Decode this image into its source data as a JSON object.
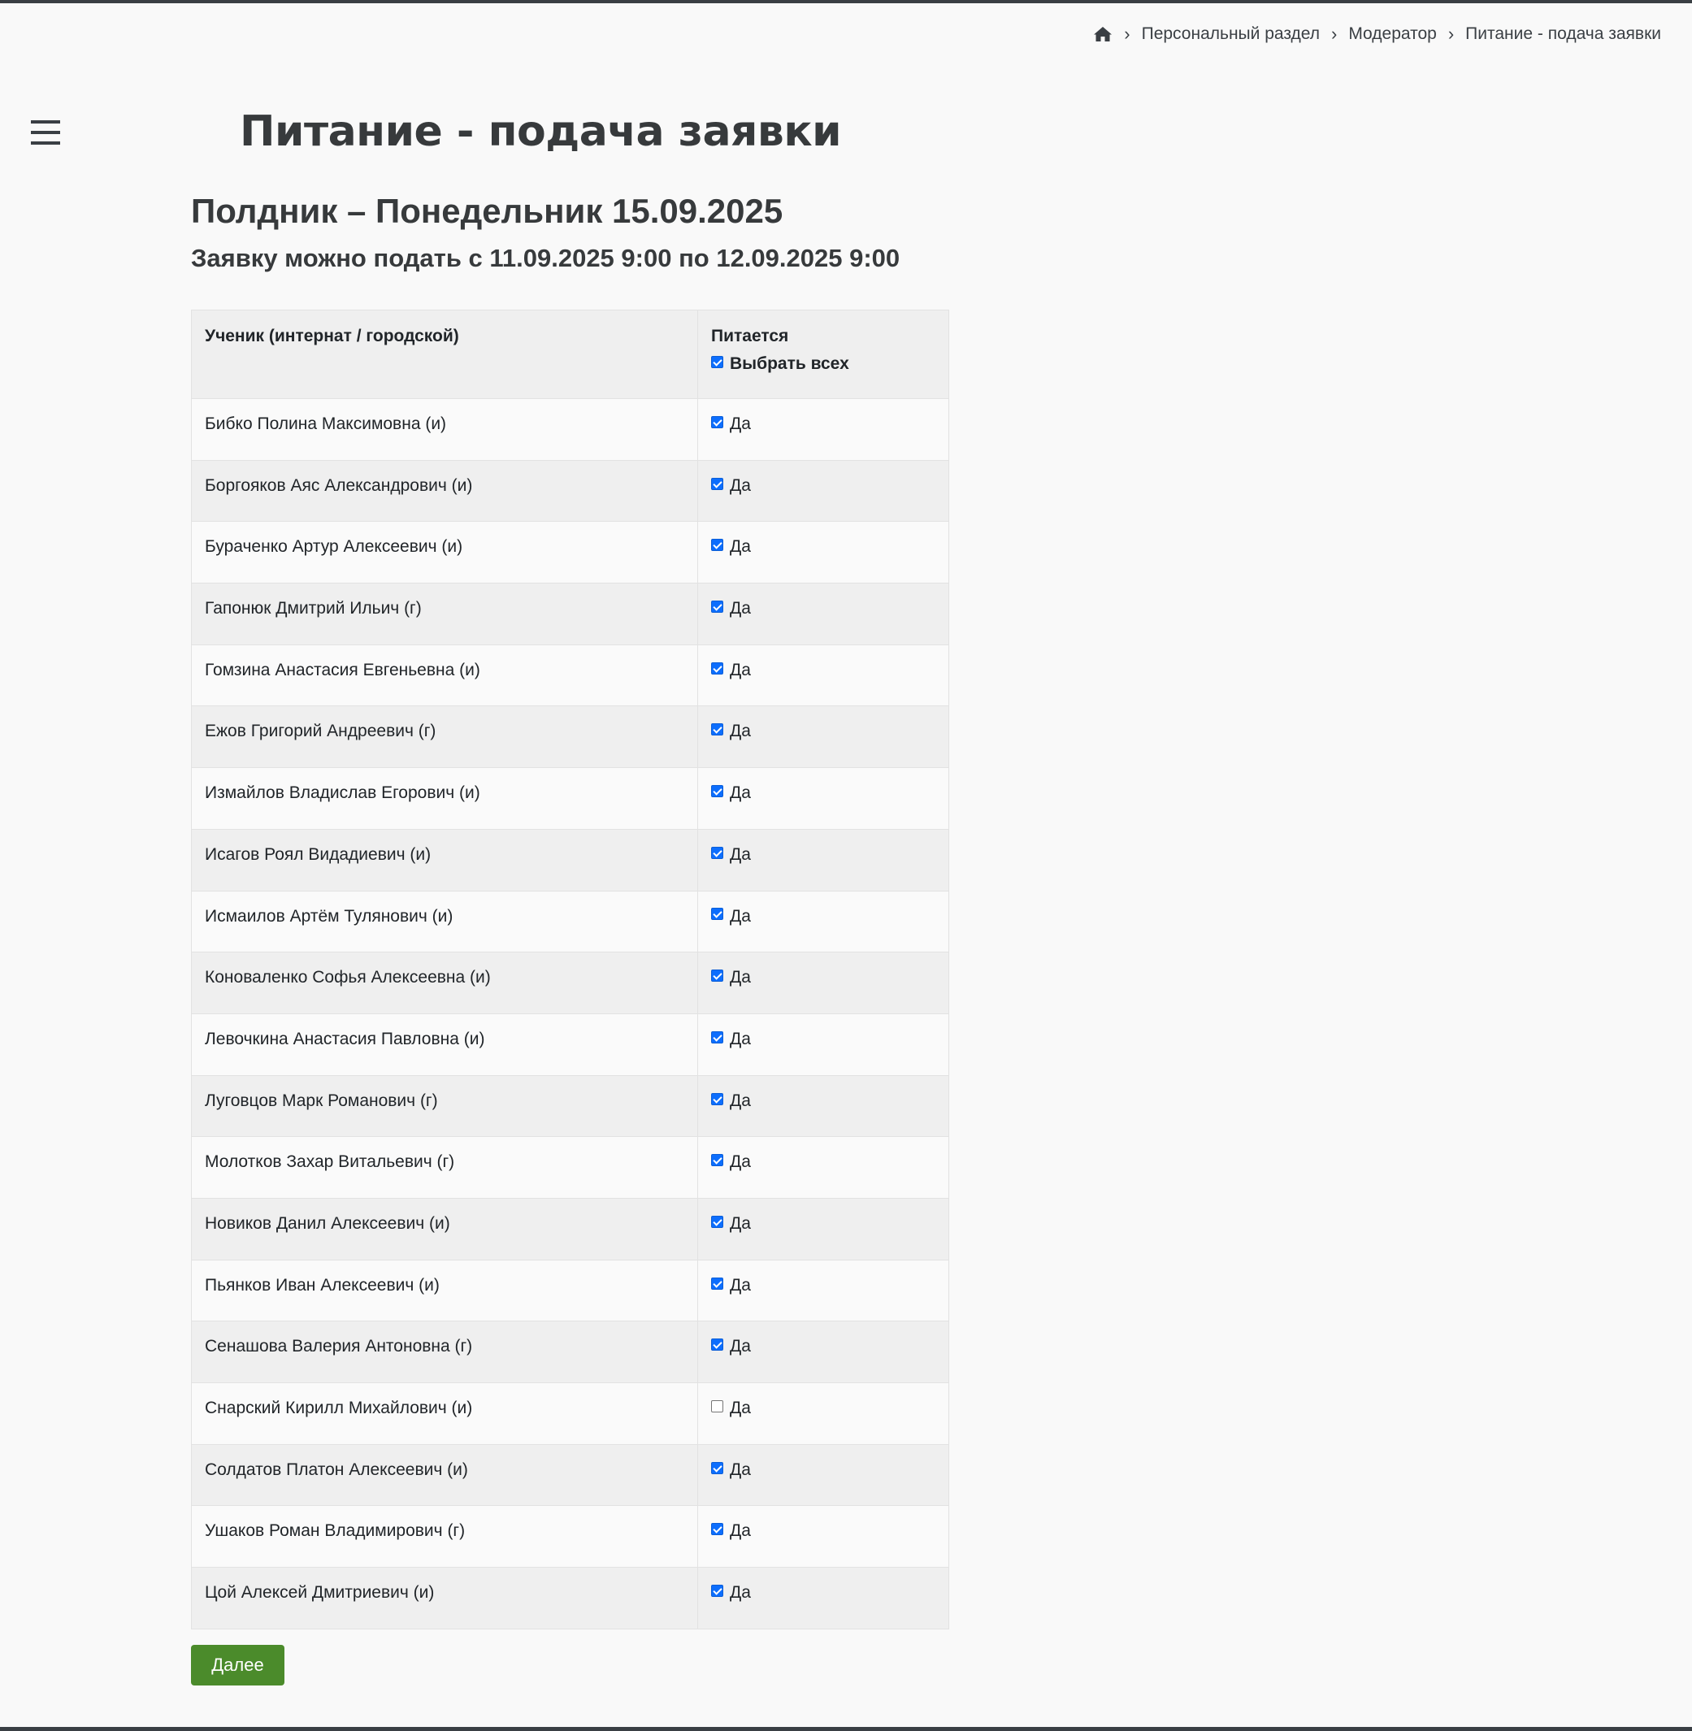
{
  "breadcrumb": {
    "items": [
      {
        "label": "Персональный раздел"
      },
      {
        "label": "Модератор"
      },
      {
        "label": "Питание - подача заявки"
      }
    ]
  },
  "page": {
    "title": "Питание - подача заявки"
  },
  "meal": {
    "heading": "Полдник – Понедельник 15.09.2025",
    "window": "Заявку можно подать с 11.09.2025 9:00 по 12.09.2025 9:00"
  },
  "table": {
    "headers": {
      "student": "Ученик (интернат / городской)",
      "eats": "Питается",
      "select_all": "Выбрать всех"
    },
    "select_all_checked": true,
    "yes_label": "Да",
    "rows": [
      {
        "name": "Бибко Полина Максимовна (и)",
        "checked": true
      },
      {
        "name": "Боргояков Аяс Александрович (и)",
        "checked": true
      },
      {
        "name": "Бураченко Артур Алексеевич (и)",
        "checked": true
      },
      {
        "name": "Гапонюк Дмитрий Ильич (г)",
        "checked": true
      },
      {
        "name": "Гомзина Анастасия Евгеньевна (и)",
        "checked": true
      },
      {
        "name": "Ежов Григорий Андреевич (г)",
        "checked": true
      },
      {
        "name": "Измайлов Владислав Егорович (и)",
        "checked": true
      },
      {
        "name": "Исагов Роял Видадиевич (и)",
        "checked": true
      },
      {
        "name": "Исмаилов Артём Тулянович (и)",
        "checked": true
      },
      {
        "name": "Коноваленко Софья Алексеевна (и)",
        "checked": true
      },
      {
        "name": "Левочкина Анастасия Павловна (и)",
        "checked": true
      },
      {
        "name": "Луговцов Марк Романович (г)",
        "checked": true
      },
      {
        "name": "Молотков Захар Витальевич (г)",
        "checked": true
      },
      {
        "name": "Новиков Данил Алексеевич (и)",
        "checked": true
      },
      {
        "name": "Пьянков Иван Алексеевич (и)",
        "checked": true
      },
      {
        "name": "Сенашова Валерия Антоновна (г)",
        "checked": true
      },
      {
        "name": "Снарский Кирилл Михайлович (и)",
        "checked": false
      },
      {
        "name": "Солдатов Платон Алексеевич (и)",
        "checked": true
      },
      {
        "name": "Ушаков Роман Владимирович (г)",
        "checked": true
      },
      {
        "name": "Цой Алексей Дмитриевич (и)",
        "checked": true
      }
    ]
  },
  "actions": {
    "next_label": "Далее"
  },
  "colors": {
    "button_bg": "#4b8b2b",
    "checkbox": "#0d6efd",
    "text": "#373a3c"
  },
  "icons": {
    "home": "home-icon",
    "separator": "chevron-right-icon",
    "menu": "hamburger-menu-icon"
  }
}
